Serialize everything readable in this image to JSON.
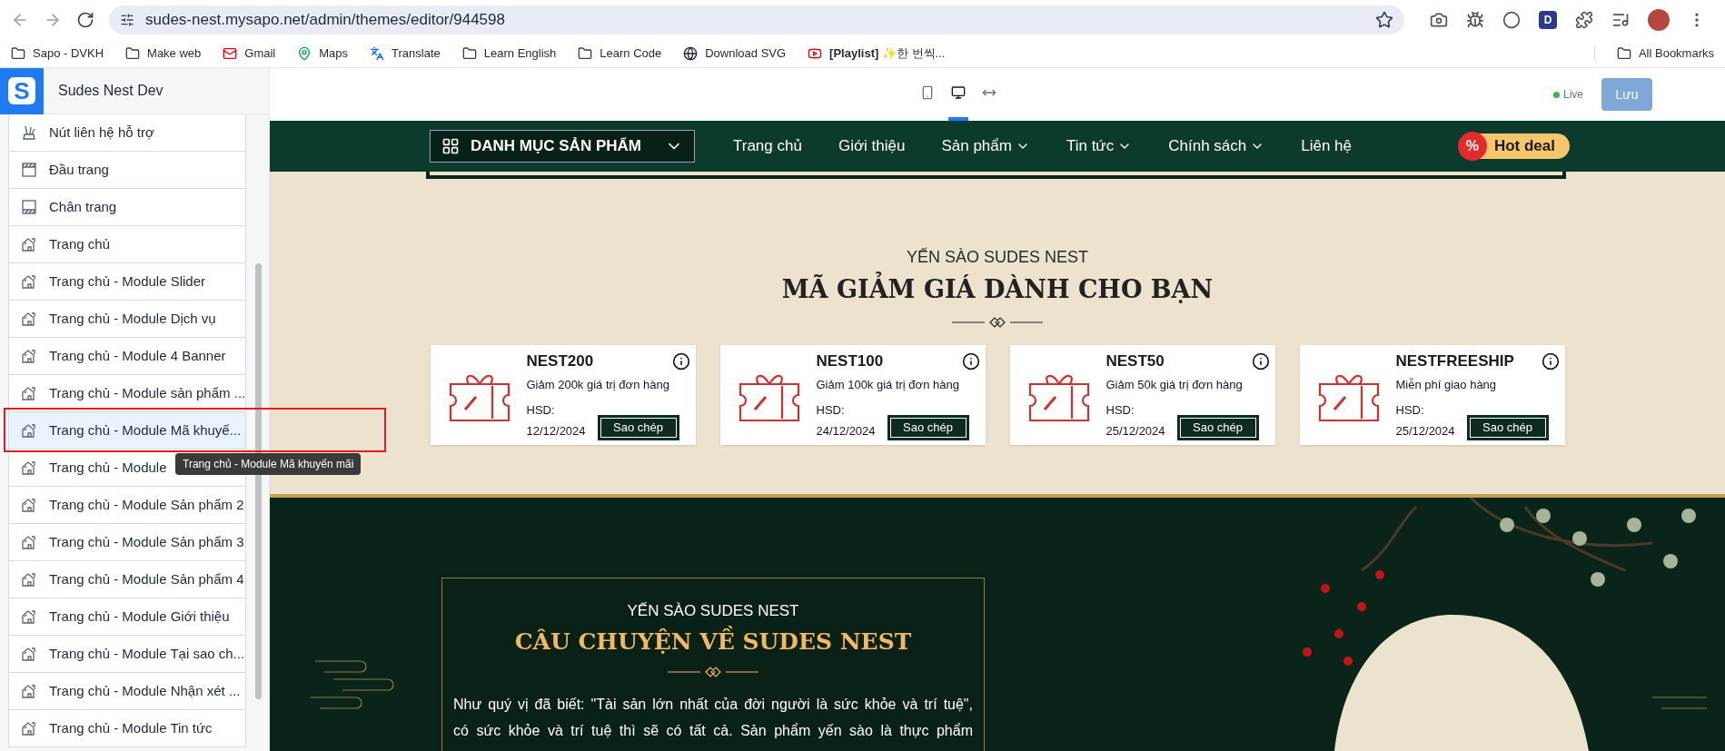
{
  "browser": {
    "url": "sudes-nest.mysapo.net/admin/themes/editor/944598",
    "extension_badge": "D",
    "bookmarks": [
      {
        "label": "Sapo - DVKH",
        "kind": "folder"
      },
      {
        "label": "Make web",
        "kind": "folder"
      },
      {
        "label": "Gmail",
        "kind": "mail"
      },
      {
        "label": "Maps",
        "kind": "pin"
      },
      {
        "label": "Translate",
        "kind": "translate"
      },
      {
        "label": "Learn English",
        "kind": "folder"
      },
      {
        "label": "Learn Code",
        "kind": "folder"
      },
      {
        "label": "Download SVG",
        "kind": "globe"
      },
      {
        "label": "**[Playlist]** ✨한 번씩...",
        "kind": "video"
      }
    ],
    "all_bookmarks": "All Bookmarks"
  },
  "sidebar": {
    "logo": "S",
    "title": "Sudes Nest Dev",
    "items": [
      {
        "label": "Nút liên hệ hỗ trợ",
        "kind": "contact",
        "selected": false
      },
      {
        "label": "Đầu trang",
        "kind": "header",
        "selected": false
      },
      {
        "label": "Chân trang",
        "kind": "footer",
        "selected": false
      },
      {
        "label": "Trang chủ",
        "kind": "page",
        "selected": false
      },
      {
        "label": "Trang chủ - Module Slider",
        "kind": "page",
        "selected": false
      },
      {
        "label": "Trang chủ - Module Dịch vụ",
        "kind": "page",
        "selected": false
      },
      {
        "label": "Trang chủ - Module 4 Banner",
        "kind": "page",
        "selected": false
      },
      {
        "label": "Trang chủ - Module sản phẩm ...",
        "kind": "page",
        "selected": false
      },
      {
        "label": "Trang chủ - Module Mã khuyế...",
        "kind": "page",
        "selected": true
      },
      {
        "label": "Trang chủ - Module",
        "kind": "page",
        "selected": false
      },
      {
        "label": "Trang chủ - Module Sản phẩm 2",
        "kind": "page",
        "selected": false
      },
      {
        "label": "Trang chủ - Module Sản phẩm 3",
        "kind": "page",
        "selected": false
      },
      {
        "label": "Trang chủ - Module Sản phẩm 4",
        "kind": "page",
        "selected": false
      },
      {
        "label": "Trang chủ - Module Giới thiệu",
        "kind": "page",
        "selected": false
      },
      {
        "label": "Trang chủ - Module Tại sao ch...",
        "kind": "page",
        "selected": false
      },
      {
        "label": "Trang chủ - Module Nhận xét ...",
        "kind": "page",
        "selected": false
      },
      {
        "label": "Trang chủ - Module Tin tức",
        "kind": "page",
        "selected": false
      }
    ],
    "tooltip": "Trang chủ - Module Mã khuyến mãi"
  },
  "editor_toolbar": {
    "devices": [
      {
        "kind": "mobile",
        "selected": false
      },
      {
        "kind": "desktop",
        "selected": true
      },
      {
        "kind": "fullwidth",
        "selected": false
      }
    ],
    "status": "Live",
    "save": "Lưu"
  },
  "nav": {
    "category": "DANH MỤC SẢN PHẨM",
    "links": [
      {
        "label": "Trang chủ",
        "dropdown": false
      },
      {
        "label": "Giới thiệu",
        "dropdown": false
      },
      {
        "label": "Sản phẩm",
        "dropdown": true
      },
      {
        "label": "Tin tức",
        "dropdown": true
      },
      {
        "label": "Chính sách",
        "dropdown": true
      },
      {
        "label": "Liên hệ",
        "dropdown": false
      }
    ],
    "hot_deal": {
      "badge": "%",
      "label": "Hot deal"
    }
  },
  "coupon_section": {
    "eyebrow": "YẾN SÀO SUDES NEST",
    "title": "MÃ GIẢM GIÁ DÀNH CHO BẠN",
    "coupons": [
      {
        "code": "NEST200",
        "description": "Giảm 200k giá trị đơn hàng",
        "expiry_label": "HSD:",
        "expiry": "12/12/2024",
        "button": "Sao chép"
      },
      {
        "code": "NEST100",
        "description": "Giảm 100k giá trị đơn hàng",
        "expiry_label": "HSD:",
        "expiry": "24/12/2024",
        "button": "Sao chép"
      },
      {
        "code": "NEST50",
        "description": "Giảm 50k giá trị đơn hàng",
        "expiry_label": "HSD:",
        "expiry": "25/12/2024",
        "button": "Sao chép"
      },
      {
        "code": "NESTFREESHIP",
        "description": "Miễn phí giao hàng",
        "expiry_label": "HSD:",
        "expiry": "25/12/2024",
        "button": "Sao chép"
      }
    ]
  },
  "story": {
    "eyebrow": "YẾN SÀO SUDES NEST",
    "title": "CÂU CHUYỆN VỀ SUDES NEST",
    "lines": [
      "Như quý vị đã biết: \"Tài sản lớn nhất của đời người là sức khỏe và trí tuệ\",",
      "có sức khỏe và trí tuệ thì sẽ có tất cả. Sản phẩm yến sào là thực phẩm"
    ]
  }
}
